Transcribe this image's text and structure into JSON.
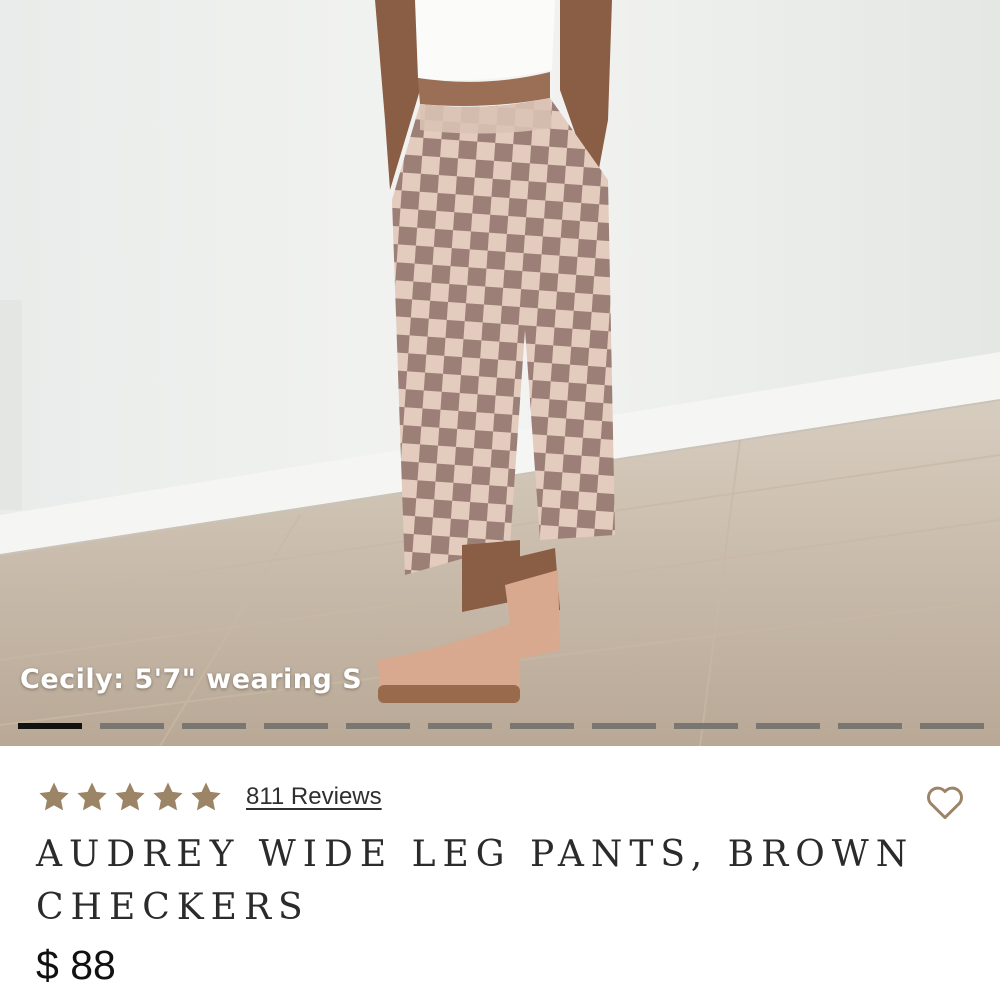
{
  "gallery": {
    "caption": "Cecily: 5'7\" wearing S",
    "slide_count": 12,
    "active_index": 0
  },
  "product": {
    "rating": 5,
    "rating_max": 5,
    "reviews_label": "811 Reviews",
    "title": "AUDREY WIDE LEG PANTS, BROWN CHECKERS",
    "price": "$ 88"
  },
  "colors": {
    "star": "#9c8466",
    "heart_outline": "#9c8466",
    "indicator_active": "#111111",
    "indicator_inactive": "#7a7672"
  },
  "icons": {
    "star": "star-icon",
    "favorite": "heart-outline-icon"
  }
}
